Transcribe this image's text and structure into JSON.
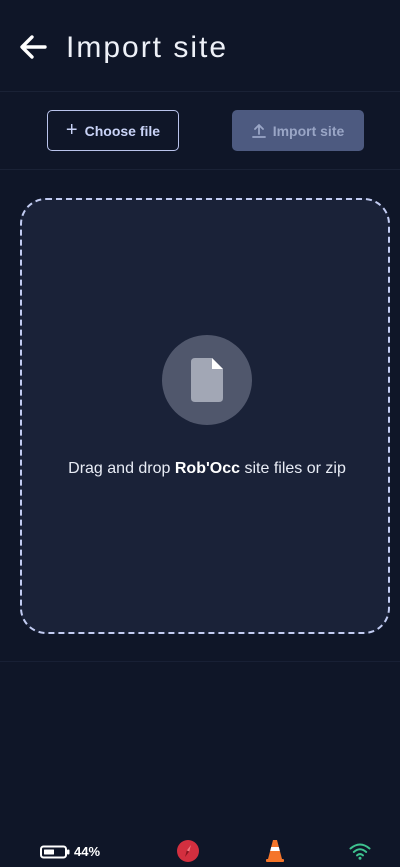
{
  "header": {
    "title": "Import site",
    "back_icon": "arrow-left-icon"
  },
  "toolbar": {
    "choose_label": "Choose file",
    "choose_icon": "plus-icon",
    "import_label": "Import site",
    "import_icon": "upload-icon",
    "import_enabled": false
  },
  "dropzone": {
    "icon": "file-icon",
    "text_before": "Drag and drop ",
    "text_bold": "Rob'Occ",
    "text_after": " site files or zip"
  },
  "status": {
    "battery": "44%",
    "battery_icon": "battery-icon",
    "compass_icon": "compass-icon",
    "cone_icon": "traffic-cone-icon",
    "wifi_icon": "wifi-icon"
  },
  "colors": {
    "background": "#0f1628",
    "dropzone_bg": "#1a2238",
    "dropzone_border": "#c2ccf2",
    "accent": "#b9c3ec",
    "import_disabled_bg": "#4d5a80",
    "wifi": "#3ec28f",
    "cone": "#f5752a",
    "compass": "#d32f3f"
  }
}
